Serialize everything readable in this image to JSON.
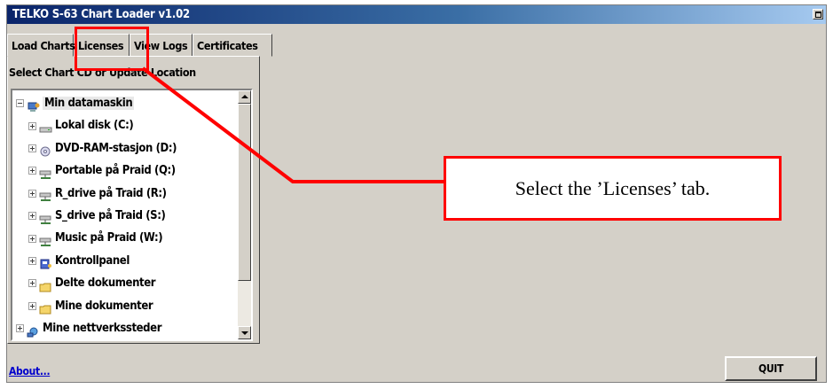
{
  "window": {
    "title": "TELKO S-63 Chart Loader v1.02"
  },
  "tabs": [
    {
      "label": "Load Charts",
      "active": true
    },
    {
      "label": "Licenses",
      "active": false
    },
    {
      "label": "View Logs",
      "active": false
    },
    {
      "label": "Certificates",
      "active": false
    }
  ],
  "panel": {
    "caption": "Select Chart CD or Update Location"
  },
  "tree": {
    "items": [
      {
        "label": "Min datamaskin",
        "icon": "computer-icon",
        "expander": "minus",
        "level": 0
      },
      {
        "label": "Lokal disk (C:)",
        "icon": "hard-drive-icon",
        "expander": "plus",
        "level": 1
      },
      {
        "label": "DVD-RAM-stasjon (D:)",
        "icon": "dvd-drive-icon",
        "expander": "plus",
        "level": 1
      },
      {
        "label": "Portable på Praid (Q:)",
        "icon": "network-drive-icon",
        "expander": "plus",
        "level": 1
      },
      {
        "label": "R_drive på Traid (R:)",
        "icon": "network-drive-icon",
        "expander": "plus",
        "level": 1
      },
      {
        "label": "S_drive på Traid (S:)",
        "icon": "network-drive-icon",
        "expander": "plus",
        "level": 1
      },
      {
        "label": "Music på Praid (W:)",
        "icon": "network-drive-icon",
        "expander": "plus",
        "level": 1
      },
      {
        "label": "Kontrollpanel",
        "icon": "control-panel-icon",
        "expander": "plus",
        "level": 1
      },
      {
        "label": "Delte dokumenter",
        "icon": "folder-icon",
        "expander": "plus",
        "level": 1
      },
      {
        "label": "Mine dokumenter",
        "icon": "folder-icon",
        "expander": "plus",
        "level": 1
      },
      {
        "label": "Mine nettverkssteder",
        "icon": "network-places-icon",
        "expander": "plus",
        "level": 0
      }
    ]
  },
  "footer": {
    "about_link": "About...",
    "quit_button": "QUIT"
  },
  "annotation": {
    "callout_text": "Select the ’Licenses’ tab.",
    "highlight_color": "#ff0000"
  }
}
